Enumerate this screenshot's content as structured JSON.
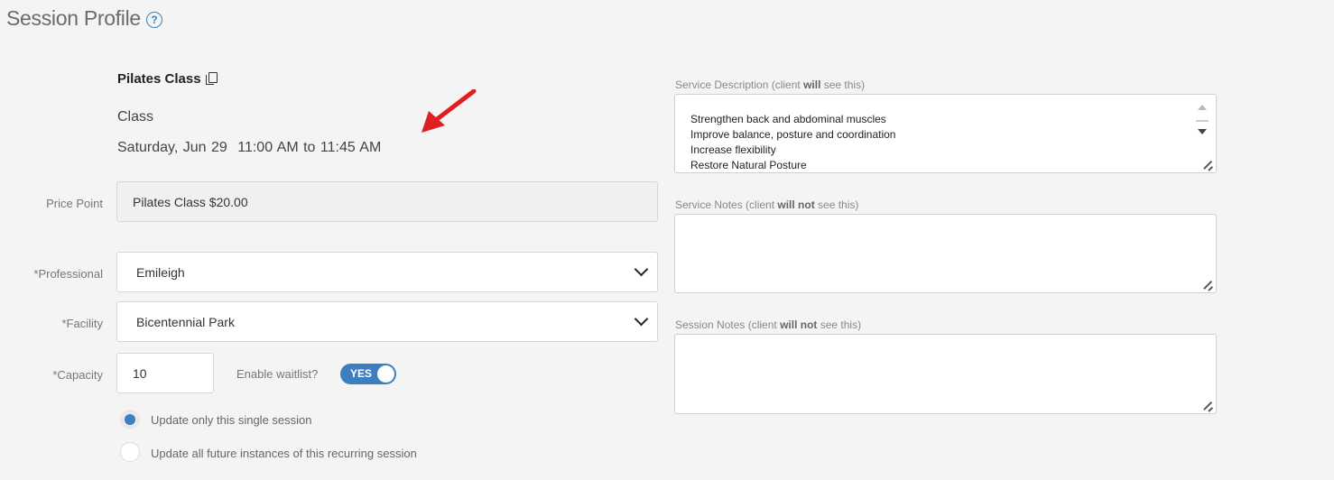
{
  "header": {
    "title": "Session Profile",
    "help_glyph": "?"
  },
  "service": {
    "name": "Pilates Class",
    "type": "Class",
    "date": "Saturday, Jun 29",
    "time": "11:00 AM to 11:45 AM"
  },
  "form": {
    "price_point": {
      "label": "Price Point",
      "value": "Pilates Class $20.00"
    },
    "professional": {
      "label": "*Professional",
      "value": "Emileigh"
    },
    "facility": {
      "label": "*Facility",
      "value": "Bicentennial Park"
    },
    "capacity": {
      "label": "*Capacity",
      "value": "10"
    },
    "waitlist": {
      "label": "Enable waitlist?",
      "toggle_text": "YES",
      "enabled": true
    },
    "update_options": [
      {
        "label": "Update only this single session",
        "checked": true
      },
      {
        "label": "Update all future instances of this recurring session",
        "checked": false
      }
    ]
  },
  "right_panel": {
    "service_description": {
      "label_prefix": "Service Description (client ",
      "label_bold": "will",
      "label_suffix": " see this)",
      "value": "Strengthen back and abdominal muscles\nImprove balance, posture and coordination\nIncrease flexibility\nRestore Natural Posture"
    },
    "service_notes": {
      "label_prefix": "Service Notes (client ",
      "label_bold": "will not",
      "label_suffix": " see this)",
      "value": ""
    },
    "session_notes": {
      "label_prefix": "Session Notes (client ",
      "label_bold": "will not",
      "label_suffix": " see this)",
      "value": ""
    }
  },
  "colors": {
    "accent": "#3d7ec1",
    "arrow": "#e02020",
    "background": "#f4f4f4"
  }
}
